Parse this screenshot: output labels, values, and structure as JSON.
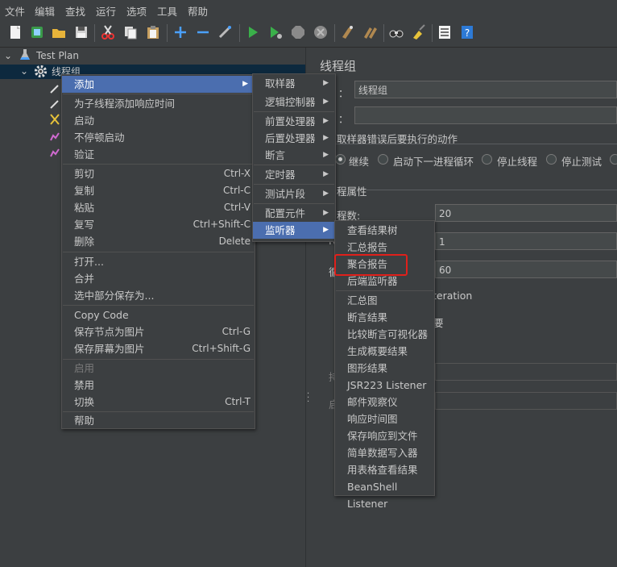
{
  "menubar": [
    "文件",
    "编辑",
    "查找",
    "运行",
    "选项",
    "工具",
    "帮助"
  ],
  "tree": {
    "root": "Test Plan",
    "thread_group": "线程组"
  },
  "right": {
    "title": "线程组",
    "name_label": "：",
    "name_value": "线程组",
    "comment_label": "：",
    "on_error_title": "取样器错误后要执行的动作",
    "on_error_options": [
      "继续",
      "启动下一进程循环",
      "停止线程",
      "停止测试"
    ],
    "props_title": "程属性",
    "threads_label": "程数:",
    "threads_value": "20",
    "rampup_label": "R",
    "rampup_value": "1",
    "loop_label": "循",
    "loop_value": "60",
    "iteration_text": "teration",
    "delay_text": "要",
    "duration_label": "持",
    "startup_label": "启"
  },
  "context_menu": {
    "items": [
      {
        "label": "添加",
        "sub": true
      },
      {
        "label": "为子线程添加响应时间"
      },
      {
        "label": "启动"
      },
      {
        "label": "不停顿启动"
      },
      {
        "label": "验证"
      },
      {
        "label": "剪切",
        "acc": "Ctrl-X"
      },
      {
        "label": "复制",
        "acc": "Ctrl-C"
      },
      {
        "label": "粘贴",
        "acc": "Ctrl-V"
      },
      {
        "label": "复写",
        "acc": "Ctrl+Shift-C"
      },
      {
        "label": "删除",
        "acc": "Delete"
      },
      {
        "label": "打开..."
      },
      {
        "label": "合并"
      },
      {
        "label": "选中部分保存为..."
      },
      {
        "label": "Copy Code"
      },
      {
        "label": "保存节点为图片",
        "acc": "Ctrl-G"
      },
      {
        "label": "保存屏幕为图片",
        "acc": "Ctrl+Shift-G"
      },
      {
        "label": "启用"
      },
      {
        "label": "禁用"
      },
      {
        "label": "切换",
        "acc": "Ctrl-T"
      },
      {
        "label": "帮助"
      }
    ]
  },
  "add_menu": {
    "items": [
      "取样器",
      "逻辑控制器",
      "前置处理器",
      "后置处理器",
      "断言",
      "定时器",
      "测试片段",
      "配置元件",
      "监听器"
    ]
  },
  "listener_menu": {
    "items": [
      "查看结果树",
      "汇总报告",
      "聚合报告",
      "后端监听器",
      "汇总图",
      "断言结果",
      "比较断言可视化器",
      "生成概要结果",
      "图形结果",
      "JSR223 Listener",
      "邮件观察仪",
      "响应时间图",
      "保存响应到文件",
      "简单数据写入器",
      "用表格查看结果",
      "BeanShell Listener"
    ]
  },
  "colors": {
    "background": "#3c3f41",
    "highlight": "#4b6eaf",
    "tree_selection": "#0d293e",
    "annotation": "#e0201b"
  }
}
